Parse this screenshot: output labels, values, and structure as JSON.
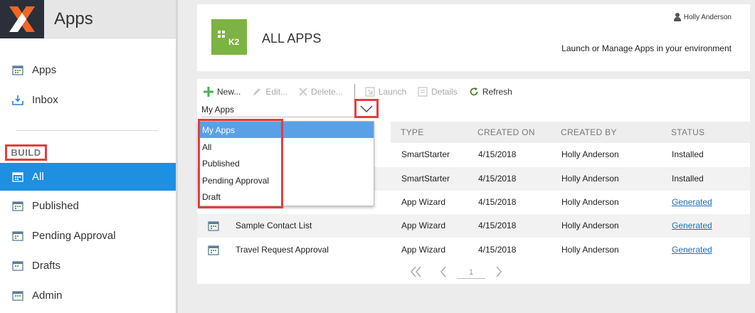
{
  "app": {
    "title": "Apps"
  },
  "sidebar": {
    "top_items": [
      {
        "label": "Apps",
        "icon": "app-grid-icon"
      },
      {
        "label": "Inbox",
        "icon": "inbox-icon"
      }
    ],
    "section_label": "BUILD",
    "build_items": [
      {
        "label": "All",
        "icon": "app-grid-icon",
        "active": true
      },
      {
        "label": "Published",
        "icon": "app-grid-icon"
      },
      {
        "label": "Pending Approval",
        "icon": "app-grid-icon"
      },
      {
        "label": "Drafts",
        "icon": "app-grid-icon"
      },
      {
        "label": "Admin",
        "icon": "app-grid-icon"
      }
    ]
  },
  "header": {
    "logo_text": "K2",
    "title": "ALL APPS",
    "user_name": "Holly Anderson",
    "tagline": "Launch or Manage Apps in your environment"
  },
  "toolbar": {
    "new_label": "New...",
    "edit_label": "Edit...",
    "delete_label": "Delete...",
    "launch_label": "Launch",
    "details_label": "Details",
    "refresh_label": "Refresh"
  },
  "filter": {
    "selected": "My Apps",
    "options": [
      "My Apps",
      "All",
      "Published",
      "Pending Approval",
      "Draft"
    ]
  },
  "table": {
    "columns": [
      "TYPE",
      "CREATED ON",
      "CREATED BY",
      "STATUS"
    ],
    "rows": [
      {
        "name": "",
        "type": "SmartStarter",
        "created_on": "4/15/2018",
        "created_by": "Holly Anderson",
        "status": "Installed",
        "status_link": false
      },
      {
        "name": "",
        "type": "SmartStarter",
        "created_on": "4/15/2018",
        "created_by": "Holly Anderson",
        "status": "Installed",
        "status_link": false
      },
      {
        "name": "",
        "type": "App Wizard",
        "created_on": "4/15/2018",
        "created_by": "Holly Anderson",
        "status": "Generated",
        "status_link": true
      },
      {
        "name": "Sample Contact List",
        "type": "App Wizard",
        "created_on": "4/15/2018",
        "created_by": "Holly Anderson",
        "status": "Generated",
        "status_link": true
      },
      {
        "name": "Travel Request Approval",
        "type": "App Wizard",
        "created_on": "4/15/2018",
        "created_by": "Holly Anderson",
        "status": "Generated",
        "status_link": true
      }
    ]
  },
  "pager": {
    "page": "1"
  },
  "colors": {
    "accent": "#1e8fe1",
    "brand_green": "#7cb342",
    "highlight": "#e53d3d",
    "link": "#1f6fb8"
  }
}
